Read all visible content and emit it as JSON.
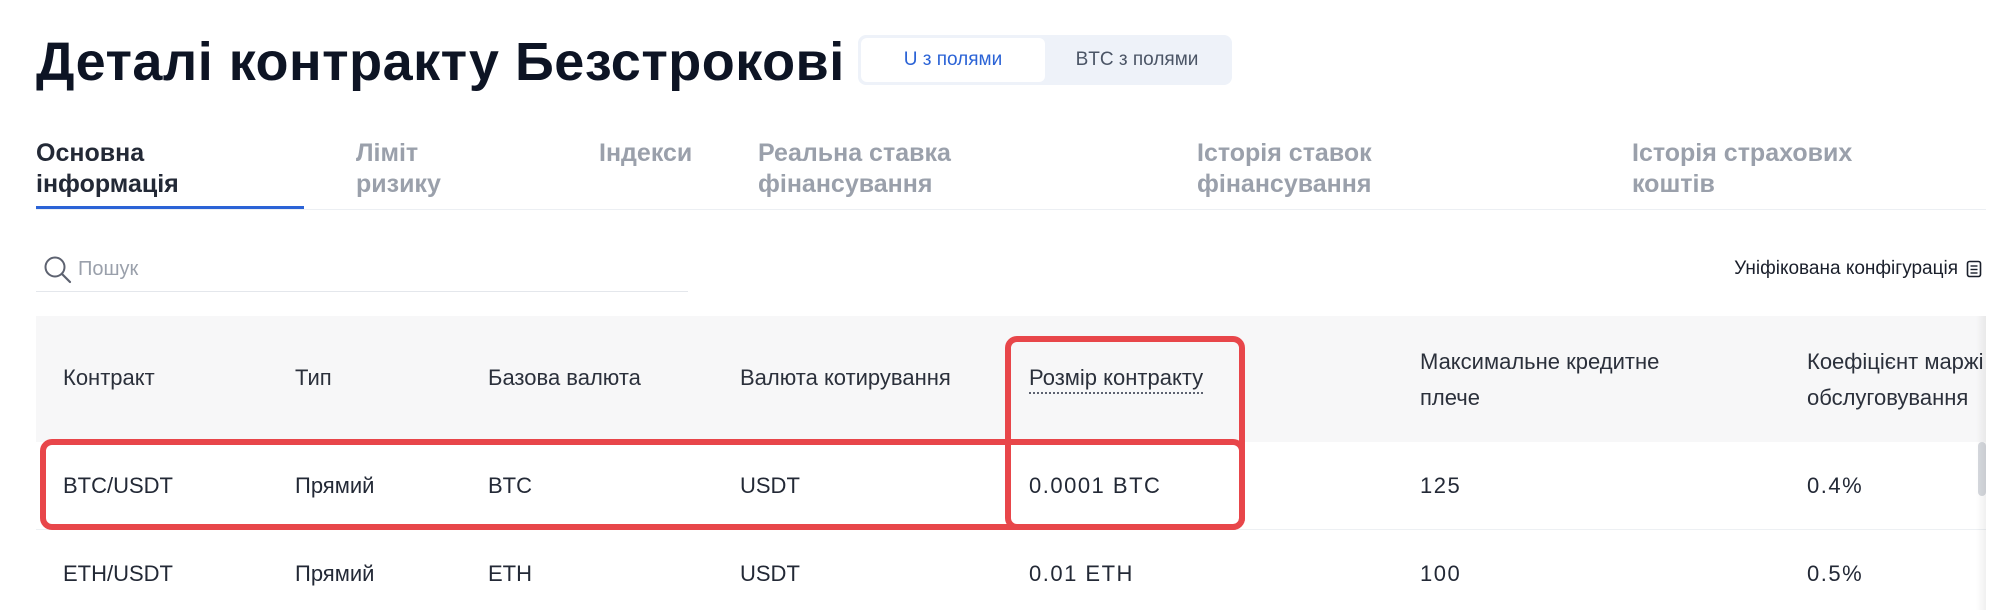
{
  "page_title": "Деталі контракту Безстрокові",
  "segment": {
    "u_label": "U з полями",
    "btc_label": "BTC з полями",
    "selected": "u"
  },
  "tabs": [
    {
      "label": "Основна\nінформація",
      "active": true
    },
    {
      "label": "Ліміт\nризику",
      "active": false
    },
    {
      "label": "Індекси",
      "active": false
    },
    {
      "label": "Реальна ставка\nфінансування",
      "active": false
    },
    {
      "label": "Історія ставок\nфінансування",
      "active": false
    },
    {
      "label": "Історія страхових\nкоштів",
      "active": false
    }
  ],
  "search": {
    "placeholder": "Пошук",
    "value": ""
  },
  "unified_config": {
    "label": "Уніфікована конфігурація",
    "icon": "calculator-icon"
  },
  "table": {
    "headers": {
      "contract": "Контракт",
      "type": "Тип",
      "base": "Базова валюта",
      "quote": "Валюта котирування",
      "size": "Розмір контракту",
      "leverage": "Максимальне кредитне\nплече",
      "margin": "Коефіцієнт маржі\nобслуговування"
    },
    "rows": [
      {
        "contract": "BTC/USDT",
        "type": "Прямий",
        "base": "BTC",
        "quote": "USDT",
        "size": "0.0001 BTC",
        "leverage": "125",
        "margin": "0.4%"
      },
      {
        "contract": "ETH/USDT",
        "type": "Прямий",
        "base": "ETH",
        "quote": "USDT",
        "size": "0.01 ETH",
        "leverage": "100",
        "margin": "0.5%"
      }
    ]
  },
  "colors": {
    "accent": "#2b63d6",
    "highlight": "#e8464a",
    "title": "#0d1424",
    "muted": "#9aa0ab"
  }
}
